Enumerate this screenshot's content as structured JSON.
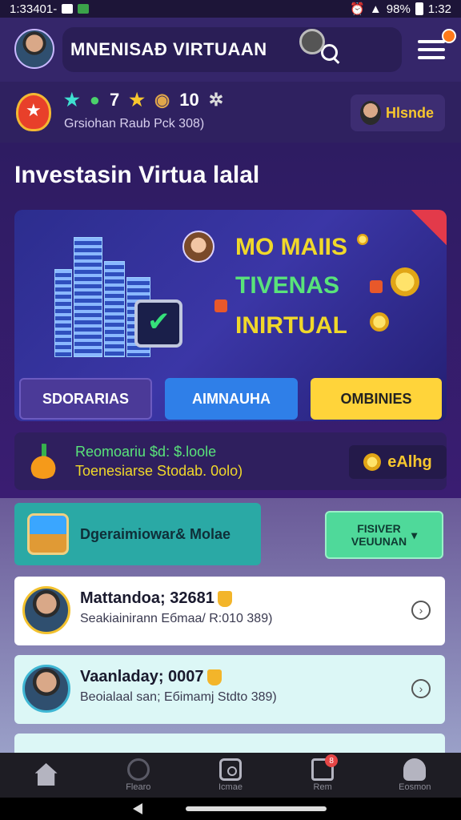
{
  "status_bar": {
    "time_left": "1:33401-",
    "battery": "98%",
    "time_right": "1:32"
  },
  "header": {
    "title": "MNENISAÐ VIRTUAAN"
  },
  "stats": {
    "stars_count": "7",
    "tokens_count": "10",
    "subtitle": "Grsiohan Raub Pck 308)",
    "badge_label": "Hlsnde"
  },
  "section": {
    "title": "Investasin Virtua lalal"
  },
  "banner": {
    "line1": "MO MAIIS",
    "line2": "TIVENAS",
    "line3": "INIRTUAL",
    "buttons": [
      {
        "label": "SDORARIAS"
      },
      {
        "label": "AIMNAUHA"
      },
      {
        "label": "OMBINIES"
      }
    ]
  },
  "info_row": {
    "line1": "Reomoariu $d: $.loole",
    "line2": "Toenesiarse Stodab. 0olo)",
    "badge": "eAlhg"
  },
  "actions": {
    "teal_label": "Dgeraimiowar& Molae",
    "green_label_1": "FISIVER",
    "green_label_2": "VEUUNAN"
  },
  "cards": [
    {
      "name": "Mattandoa; 32681",
      "sub": "Seakiainirann Eбmaa/ R:010 389)"
    },
    {
      "name": "Vaanladay; 0007",
      "sub": "Beoialaal san; Eбimamj Stdto 389)"
    }
  ],
  "bottom_nav": [
    {
      "label": ""
    },
    {
      "label": "Flearo"
    },
    {
      "label": "Icmae"
    },
    {
      "label": "Rem"
    },
    {
      "label": "Eosmon"
    }
  ],
  "nav_badge_count": "8",
  "colors": {
    "accent": "#ffd43a",
    "primary": "#2f7fe8",
    "teal": "#2aa9a5",
    "green": "#4fd99a"
  }
}
